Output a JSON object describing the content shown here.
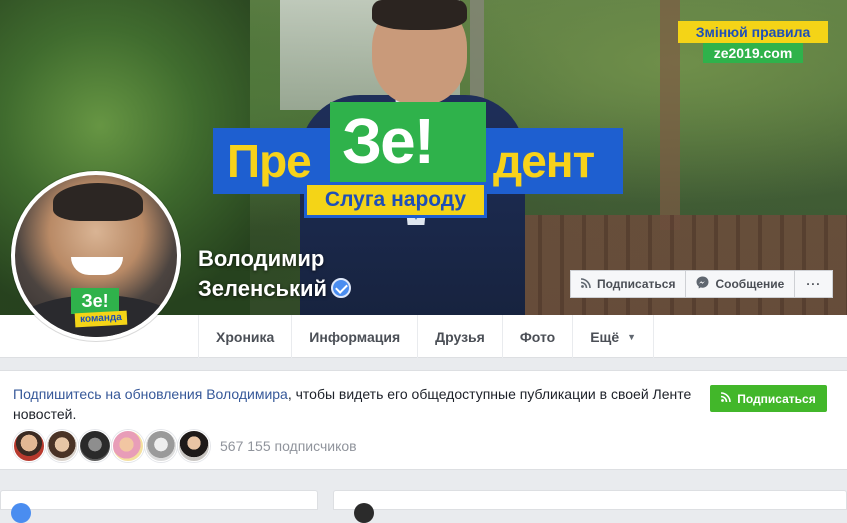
{
  "cover": {
    "poster_left": "Пре",
    "poster_ze": "Зе!",
    "poster_right": "дент",
    "poster_sub": "Слуга народу",
    "slogan_top": "Змінюй правила",
    "slogan_site": "ze2019.com"
  },
  "avatar": {
    "badge_main": "Зе!",
    "badge_sub": "команда"
  },
  "profile": {
    "name_line1": "Володимир",
    "name_line2": "Зеленський",
    "verified": true
  },
  "actions": {
    "follow_label": "Подписаться",
    "message_label": "Сообщение",
    "more_label": "···"
  },
  "tabs": [
    {
      "label": "Хроника",
      "active": true
    },
    {
      "label": "Информация"
    },
    {
      "label": "Друзья"
    },
    {
      "label": "Фото"
    },
    {
      "label": "Ещё"
    }
  ],
  "follow_card": {
    "link_text": "Подпишитесь на обновления Володимира",
    "rest_text": ", чтобы видеть его общедоступные публикации в своей Ленте новостей.",
    "button_label": "Подписаться",
    "followers_count": "567 155 подписчиков"
  },
  "colors": {
    "accent_blue": "#365899",
    "follow_green": "#42b72a",
    "poster_blue": "#1e5fd0",
    "poster_yellow": "#f4d417",
    "poster_green": "#2fb24b"
  }
}
